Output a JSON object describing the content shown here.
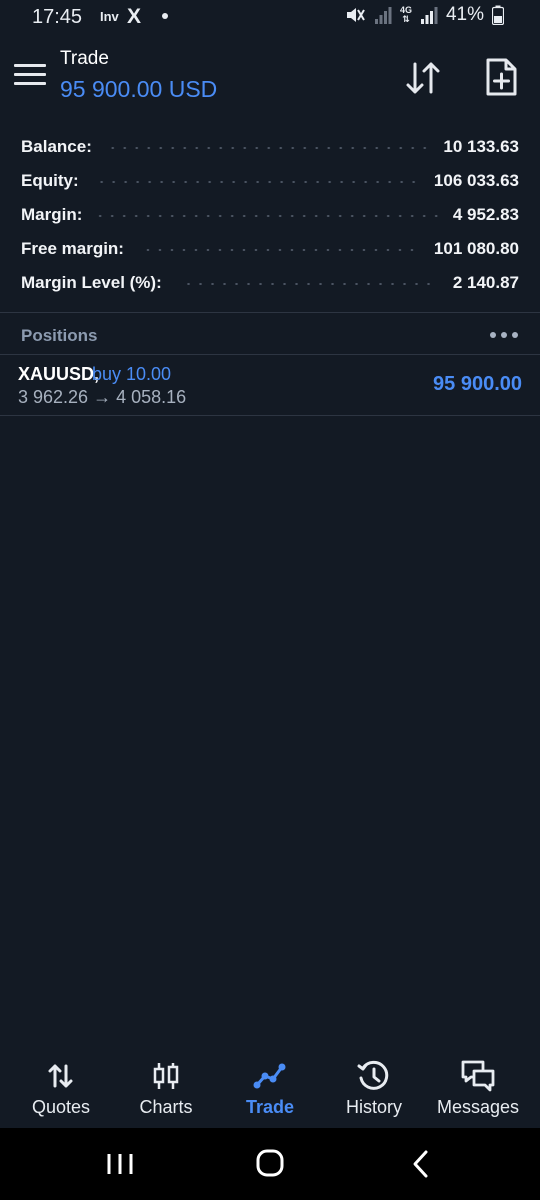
{
  "status_bar": {
    "time": "17:45",
    "app_badge": "Inv",
    "x_glyph": "X",
    "network": "4G",
    "battery": "41%"
  },
  "header": {
    "title": "Trade",
    "subtitle": "95 900.00 USD"
  },
  "summary": [
    {
      "label": "Balance:",
      "value": "10 133.63"
    },
    {
      "label": "Equity:",
      "value": "106 033.63"
    },
    {
      "label": "Margin:",
      "value": "4 952.83"
    },
    {
      "label": "Free margin:",
      "value": "101 080.80"
    },
    {
      "label": "Margin Level (%):",
      "value": "2 140.87"
    }
  ],
  "positions": {
    "title": "Positions",
    "items": [
      {
        "symbol": "XAUUSD,",
        "side": "buy 10.00",
        "prices": "3 962.26 → 4 058.16",
        "profit": "95 900.00"
      }
    ]
  },
  "bottom_nav": [
    {
      "label": "Quotes",
      "icon": "quotes-arrows-icon",
      "active": false
    },
    {
      "label": "Charts",
      "icon": "charts-candles-icon",
      "active": false
    },
    {
      "label": "Trade",
      "icon": "trade-line-icon",
      "active": true
    },
    {
      "label": "History",
      "icon": "history-clock-icon",
      "active": false
    },
    {
      "label": "Messages",
      "icon": "messages-bubbles-icon",
      "active": false
    }
  ],
  "colors": {
    "background": "#131a24",
    "accent": "#4a8cf5",
    "muted": "#8c9bb0",
    "text": "#ffffff"
  }
}
